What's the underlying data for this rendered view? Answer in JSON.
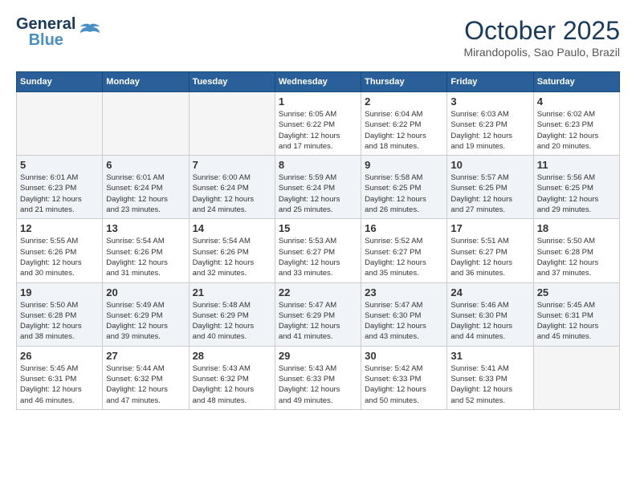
{
  "header": {
    "logo_line1": "General",
    "logo_line2": "Blue",
    "month": "October 2025",
    "location": "Mirandopolis, Sao Paulo, Brazil"
  },
  "days_of_week": [
    "Sunday",
    "Monday",
    "Tuesday",
    "Wednesday",
    "Thursday",
    "Friday",
    "Saturday"
  ],
  "weeks": [
    [
      {
        "day": "",
        "info": ""
      },
      {
        "day": "",
        "info": ""
      },
      {
        "day": "",
        "info": ""
      },
      {
        "day": "1",
        "info": "Sunrise: 6:05 AM\nSunset: 6:22 PM\nDaylight: 12 hours\nand 17 minutes."
      },
      {
        "day": "2",
        "info": "Sunrise: 6:04 AM\nSunset: 6:22 PM\nDaylight: 12 hours\nand 18 minutes."
      },
      {
        "day": "3",
        "info": "Sunrise: 6:03 AM\nSunset: 6:23 PM\nDaylight: 12 hours\nand 19 minutes."
      },
      {
        "day": "4",
        "info": "Sunrise: 6:02 AM\nSunset: 6:23 PM\nDaylight: 12 hours\nand 20 minutes."
      }
    ],
    [
      {
        "day": "5",
        "info": "Sunrise: 6:01 AM\nSunset: 6:23 PM\nDaylight: 12 hours\nand 21 minutes."
      },
      {
        "day": "6",
        "info": "Sunrise: 6:01 AM\nSunset: 6:24 PM\nDaylight: 12 hours\nand 23 minutes."
      },
      {
        "day": "7",
        "info": "Sunrise: 6:00 AM\nSunset: 6:24 PM\nDaylight: 12 hours\nand 24 minutes."
      },
      {
        "day": "8",
        "info": "Sunrise: 5:59 AM\nSunset: 6:24 PM\nDaylight: 12 hours\nand 25 minutes."
      },
      {
        "day": "9",
        "info": "Sunrise: 5:58 AM\nSunset: 6:25 PM\nDaylight: 12 hours\nand 26 minutes."
      },
      {
        "day": "10",
        "info": "Sunrise: 5:57 AM\nSunset: 6:25 PM\nDaylight: 12 hours\nand 27 minutes."
      },
      {
        "day": "11",
        "info": "Sunrise: 5:56 AM\nSunset: 6:25 PM\nDaylight: 12 hours\nand 29 minutes."
      }
    ],
    [
      {
        "day": "12",
        "info": "Sunrise: 5:55 AM\nSunset: 6:26 PM\nDaylight: 12 hours\nand 30 minutes."
      },
      {
        "day": "13",
        "info": "Sunrise: 5:54 AM\nSunset: 6:26 PM\nDaylight: 12 hours\nand 31 minutes."
      },
      {
        "day": "14",
        "info": "Sunrise: 5:54 AM\nSunset: 6:26 PM\nDaylight: 12 hours\nand 32 minutes."
      },
      {
        "day": "15",
        "info": "Sunrise: 5:53 AM\nSunset: 6:27 PM\nDaylight: 12 hours\nand 33 minutes."
      },
      {
        "day": "16",
        "info": "Sunrise: 5:52 AM\nSunset: 6:27 PM\nDaylight: 12 hours\nand 35 minutes."
      },
      {
        "day": "17",
        "info": "Sunrise: 5:51 AM\nSunset: 6:27 PM\nDaylight: 12 hours\nand 36 minutes."
      },
      {
        "day": "18",
        "info": "Sunrise: 5:50 AM\nSunset: 6:28 PM\nDaylight: 12 hours\nand 37 minutes."
      }
    ],
    [
      {
        "day": "19",
        "info": "Sunrise: 5:50 AM\nSunset: 6:28 PM\nDaylight: 12 hours\nand 38 minutes."
      },
      {
        "day": "20",
        "info": "Sunrise: 5:49 AM\nSunset: 6:29 PM\nDaylight: 12 hours\nand 39 minutes."
      },
      {
        "day": "21",
        "info": "Sunrise: 5:48 AM\nSunset: 6:29 PM\nDaylight: 12 hours\nand 40 minutes."
      },
      {
        "day": "22",
        "info": "Sunrise: 5:47 AM\nSunset: 6:29 PM\nDaylight: 12 hours\nand 41 minutes."
      },
      {
        "day": "23",
        "info": "Sunrise: 5:47 AM\nSunset: 6:30 PM\nDaylight: 12 hours\nand 43 minutes."
      },
      {
        "day": "24",
        "info": "Sunrise: 5:46 AM\nSunset: 6:30 PM\nDaylight: 12 hours\nand 44 minutes."
      },
      {
        "day": "25",
        "info": "Sunrise: 5:45 AM\nSunset: 6:31 PM\nDaylight: 12 hours\nand 45 minutes."
      }
    ],
    [
      {
        "day": "26",
        "info": "Sunrise: 5:45 AM\nSunset: 6:31 PM\nDaylight: 12 hours\nand 46 minutes."
      },
      {
        "day": "27",
        "info": "Sunrise: 5:44 AM\nSunset: 6:32 PM\nDaylight: 12 hours\nand 47 minutes."
      },
      {
        "day": "28",
        "info": "Sunrise: 5:43 AM\nSunset: 6:32 PM\nDaylight: 12 hours\nand 48 minutes."
      },
      {
        "day": "29",
        "info": "Sunrise: 5:43 AM\nSunset: 6:33 PM\nDaylight: 12 hours\nand 49 minutes."
      },
      {
        "day": "30",
        "info": "Sunrise: 5:42 AM\nSunset: 6:33 PM\nDaylight: 12 hours\nand 50 minutes."
      },
      {
        "day": "31",
        "info": "Sunrise: 5:41 AM\nSunset: 6:33 PM\nDaylight: 12 hours\nand 52 minutes."
      },
      {
        "day": "",
        "info": ""
      }
    ]
  ]
}
